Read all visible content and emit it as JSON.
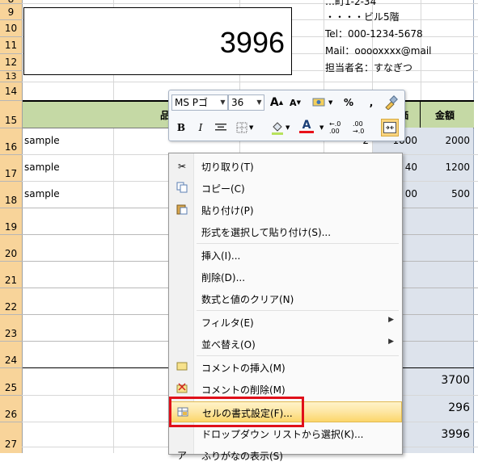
{
  "spreadsheet": {
    "rows": [
      "8",
      "9",
      "10",
      "11",
      "12",
      "13",
      "14",
      "15",
      "16",
      "17",
      "18",
      "19",
      "20",
      "21",
      "22",
      "23",
      "24",
      "25",
      "26",
      "27"
    ],
    "total_box": "3996",
    "address_lines": [
      "…町1-2-34",
      "・・・・ビル5階",
      "Tel：000-1234-5678",
      "Mail：ooooxxxx@mail",
      "担当者名：すなぎつ"
    ],
    "header_item": "品",
    "header_unit": "価",
    "header_amount": "金額",
    "items": [
      {
        "name": "sample",
        "qty": "2",
        "price": "1000",
        "amount": "2000"
      },
      {
        "name": "sample",
        "qty": "",
        "price": "40",
        "amount": "1200"
      },
      {
        "name": "sample",
        "qty": "",
        "price": "00",
        "amount": "500"
      }
    ],
    "subtotal": "3700",
    "tax": "296",
    "total": "3996"
  },
  "mini_toolbar": {
    "font_name": "MS Pゴ",
    "font_size": "36",
    "grow_font": "A",
    "shrink_font": "A",
    "percent": "%",
    "comma": ",",
    "bold": "B",
    "italic": "I",
    "font_color_letter": "A",
    "inc_decimal": "←.0 .00",
    "dec_decimal": ".00 →.0"
  },
  "context_menu": {
    "items": [
      {
        "label": "切り取り(T)",
        "icon": "scissors-icon"
      },
      {
        "label": "コピー(C)",
        "icon": "copy-icon"
      },
      {
        "label": "貼り付け(P)",
        "icon": "paste-icon"
      },
      {
        "label": "形式を選択して貼り付け(S)...",
        "icon": ""
      },
      {
        "label": "挿入(I)...",
        "icon": ""
      },
      {
        "label": "削除(D)...",
        "icon": ""
      },
      {
        "label": "数式と値のクリア(N)",
        "icon": ""
      },
      {
        "label": "フィルタ(E)",
        "icon": "",
        "submenu": true
      },
      {
        "label": "並べ替え(O)",
        "icon": "",
        "submenu": true
      },
      {
        "label": "コメントの挿入(M)",
        "icon": "comment-insert-icon"
      },
      {
        "label": "コメントの削除(M)",
        "icon": "comment-delete-icon"
      },
      {
        "label": "セルの書式設定(F)...",
        "icon": "format-cells-icon"
      },
      {
        "label": "ドロップダウン リストから選択(K)...",
        "icon": ""
      },
      {
        "label": "ふりがなの表示(S)",
        "icon": "furigana-icon"
      }
    ]
  },
  "colors": {
    "row_header_bg": "#f8d49a",
    "header_band": "#c5d9a5",
    "highlight_box": "#e0101a",
    "menu_highlight": "#fcd66a"
  }
}
